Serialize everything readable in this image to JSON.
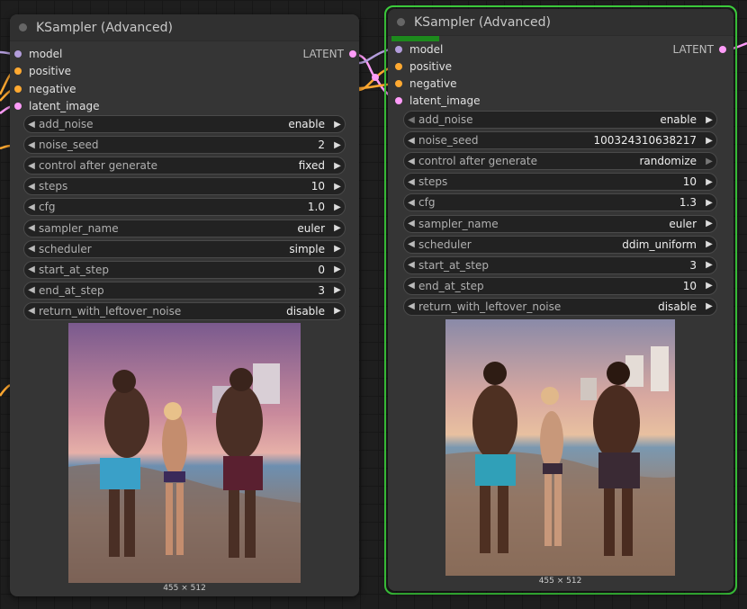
{
  "nodes": [
    {
      "title": "KSampler (Advanced)",
      "inputs": [
        "model",
        "positive",
        "negative",
        "latent_image"
      ],
      "output": "LATENT",
      "widgets": [
        {
          "name": "add_noise",
          "value": "enable"
        },
        {
          "name": "noise_seed",
          "value": "2"
        },
        {
          "name": "control after generate",
          "value": "fixed"
        },
        {
          "name": "steps",
          "value": "10"
        },
        {
          "name": "cfg",
          "value": "1.0"
        },
        {
          "name": "sampler_name",
          "value": "euler"
        },
        {
          "name": "scheduler",
          "value": "simple"
        },
        {
          "name": "start_at_step",
          "value": "0"
        },
        {
          "name": "end_at_step",
          "value": "3"
        },
        {
          "name": "return_with_leftover_noise",
          "value": "disable"
        }
      ],
      "image_size": "455 × 512"
    },
    {
      "title": "KSampler (Advanced)",
      "inputs": [
        "model",
        "positive",
        "negative",
        "latent_image"
      ],
      "output": "LATENT",
      "widgets": [
        {
          "name": "add_noise",
          "value": "enable"
        },
        {
          "name": "noise_seed",
          "value": "100324310638217"
        },
        {
          "name": "control after generate",
          "value": "randomize"
        },
        {
          "name": "steps",
          "value": "10"
        },
        {
          "name": "cfg",
          "value": "1.3"
        },
        {
          "name": "sampler_name",
          "value": "euler"
        },
        {
          "name": "scheduler",
          "value": "ddim_uniform"
        },
        {
          "name": "start_at_step",
          "value": "3"
        },
        {
          "name": "end_at_step",
          "value": "10"
        },
        {
          "name": "return_with_leftover_noise",
          "value": "disable"
        }
      ],
      "image_size": "455 × 512"
    }
  ],
  "colors": {
    "model": "#b39ddb",
    "conditioning": "#ffa931",
    "latent": "#ff9cf9",
    "selected_border": "#3fd63f",
    "progress": "#1d8a1d"
  }
}
